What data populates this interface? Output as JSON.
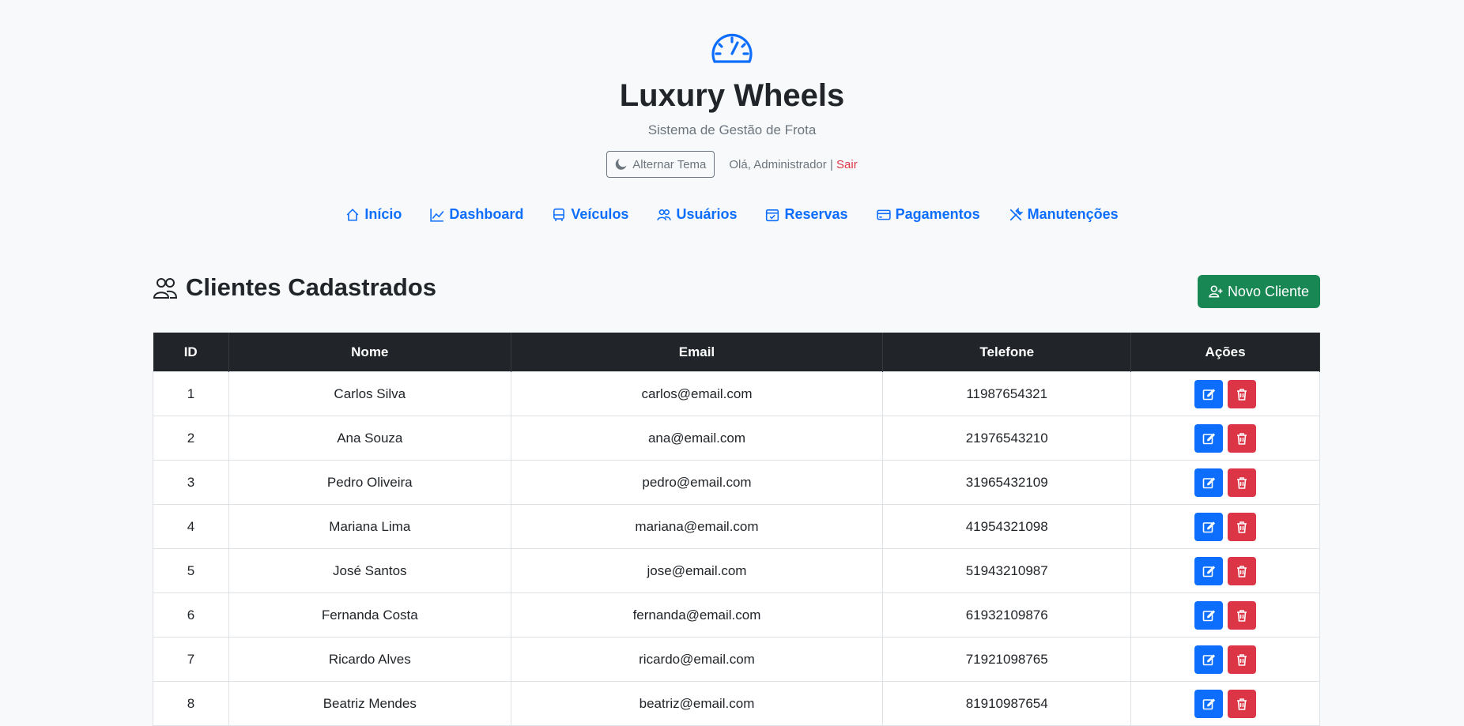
{
  "brand": {
    "title": "Luxury Wheels",
    "subtitle": "Sistema de Gestão de Frota",
    "logo_icon": "speedometer-icon",
    "accent_color": "#0d6efd"
  },
  "user_bar": {
    "theme_button": "Alternar Tema",
    "greeting": "Olá, Administrador |",
    "logout": "Sair"
  },
  "nav": {
    "items": [
      {
        "label": "Início",
        "icon": "house-icon"
      },
      {
        "label": "Dashboard",
        "icon": "chart-line-icon"
      },
      {
        "label": "Veículos",
        "icon": "bus-icon"
      },
      {
        "label": "Usuários",
        "icon": "people-icon"
      },
      {
        "label": "Reservas",
        "icon": "calendar-check-icon"
      },
      {
        "label": "Pagamentos",
        "icon": "credit-card-icon"
      },
      {
        "label": "Manutenções",
        "icon": "tools-icon"
      }
    ]
  },
  "page": {
    "title": "Clientes Cadastrados",
    "new_button": "Novo Cliente",
    "new_button_color": "#198754"
  },
  "table": {
    "headers": [
      "ID",
      "Nome",
      "Email",
      "Telefone",
      "Ações"
    ],
    "rows": [
      [
        "1",
        "Carlos Silva",
        "carlos@email.com",
        "11987654321"
      ],
      [
        "2",
        "Ana Souza",
        "ana@email.com",
        "21976543210"
      ],
      [
        "3",
        "Pedro Oliveira",
        "pedro@email.com",
        "31965432109"
      ],
      [
        "4",
        "Mariana Lima",
        "mariana@email.com",
        "41954321098"
      ],
      [
        "5",
        "José Santos",
        "jose@email.com",
        "51943210987"
      ],
      [
        "6",
        "Fernanda Costa",
        "fernanda@email.com",
        "61932109876"
      ],
      [
        "7",
        "Ricardo Alves",
        "ricardo@email.com",
        "71921098765"
      ],
      [
        "8",
        "Beatriz Mendes",
        "beatriz@email.com",
        "81910987654"
      ]
    ]
  }
}
